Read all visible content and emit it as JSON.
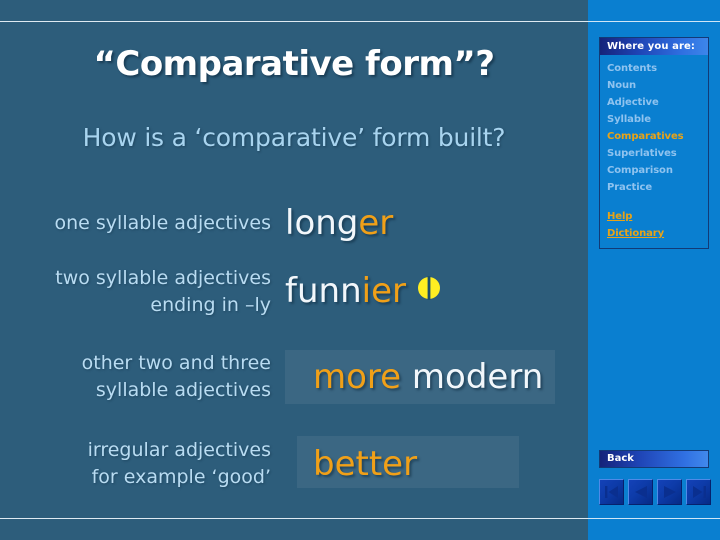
{
  "slide": {
    "title": "“Comparative form”?",
    "subtitle": "How is a ‘comparative’ form built?",
    "rows": [
      {
        "label": "one syllable adjectives",
        "example_white": "long",
        "example_orange": "er",
        "has_marker": false
      },
      {
        "label_line1": "two syllable adjectives",
        "label_line2": "ending in –ly",
        "example_white": "funn",
        "example_orange": "ier",
        "has_marker": true,
        "marker_icon": "phi-symbol-icon"
      },
      {
        "label_line1": "other two and three",
        "label_line2": "syllable adjectives",
        "example_orange": "more",
        "example_white": "modern",
        "has_marker": false
      },
      {
        "label_line1": "irregular adjectives",
        "label_line2": "for example ‘good’",
        "example_orange": "better",
        "has_marker": false
      }
    ]
  },
  "sidebar": {
    "header": "Where you are:",
    "items": [
      {
        "label": "Contents",
        "current": false
      },
      {
        "label": "Noun",
        "current": false
      },
      {
        "label": "Adjective",
        "current": false
      },
      {
        "label": "Syllable",
        "current": false
      },
      {
        "label": "Comparatives",
        "current": true
      },
      {
        "label": "Superlatives",
        "current": false
      },
      {
        "label": "Comparison",
        "current": false
      },
      {
        "label": "Practice",
        "current": false
      }
    ],
    "links": [
      {
        "label": "Help"
      },
      {
        "label": "Dictionary"
      }
    ],
    "back_label": "Back",
    "arrows": [
      {
        "name": "first-arrow-icon"
      },
      {
        "name": "previous-arrow-icon"
      },
      {
        "name": "next-arrow-icon"
      },
      {
        "name": "last-arrow-icon"
      }
    ]
  },
  "colors": {
    "background": "#2d5d7b",
    "sidebar": "#0a7fd0",
    "accent_orange": "#f0a018",
    "text_light_blue": "#b9dcf2",
    "white": "#f2f7fb",
    "marker_yellow": "#ffee22"
  }
}
